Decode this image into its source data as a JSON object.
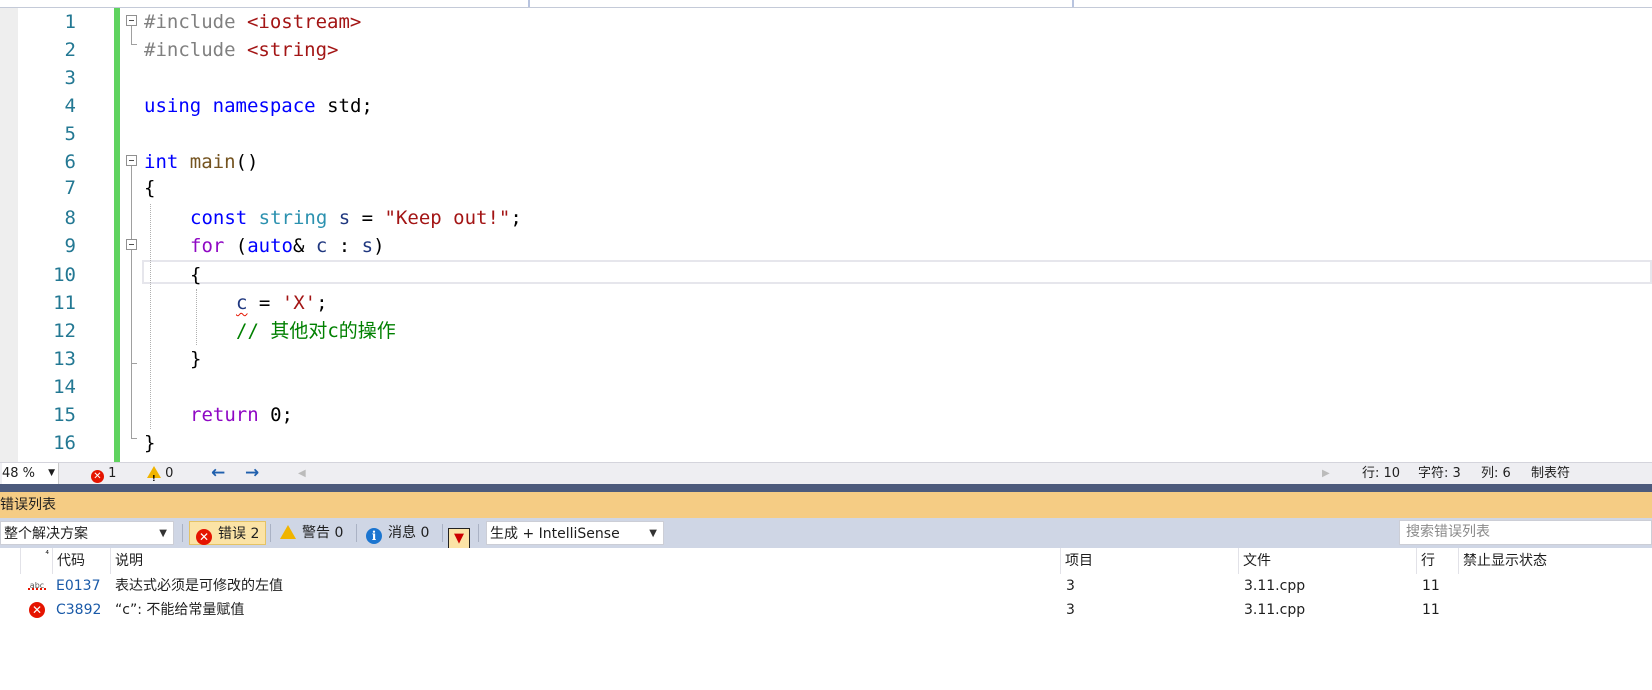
{
  "editor": {
    "line_numbers": [
      "1",
      "2",
      "3",
      "4",
      "5",
      "6",
      "7",
      "8",
      "9",
      "10",
      "11",
      "12",
      "13",
      "14",
      "15",
      "16"
    ],
    "code": {
      "l1": {
        "directive": "#include",
        "header": "<iostream>"
      },
      "l2": {
        "directive": "#include",
        "header": "<string>"
      },
      "l4": {
        "using": "using",
        "namespace": "namespace",
        "name": "std",
        "semi": ";"
      },
      "l6": {
        "type": "int",
        "func": "main",
        "parens": "()"
      },
      "l7": {
        "brace": "{"
      },
      "l8": {
        "const": "const",
        "type": "string",
        "var": "s",
        "eq": " = ",
        "value": "\"Keep out!\"",
        "semi": ";"
      },
      "l9": {
        "for": "for",
        "open": " (",
        "auto": "auto",
        "amp": "&",
        "var": "c",
        "colon": " : ",
        "range": "s",
        "close": ")"
      },
      "l10": {
        "brace": "{"
      },
      "l11": {
        "var": "c",
        "eq": " = ",
        "value": "'X'",
        "semi": ";"
      },
      "l12": {
        "comment": "// 其他对c的操作"
      },
      "l13": {
        "brace": "}"
      },
      "l15": {
        "ret": "return",
        "value": " 0;"
      },
      "l16": {
        "brace": "}"
      }
    }
  },
  "status_bar": {
    "zoom": "48 %",
    "errors": "1",
    "warnings": "0",
    "line": "行: 10",
    "char": "字符: 3",
    "col": "列: 6",
    "tabs": "制表符"
  },
  "error_list": {
    "title": "错误列表",
    "scope": "整个解决方案",
    "errors_btn": "错误 2",
    "warnings_btn": "警告 0",
    "messages_btn": "消息 0",
    "build_source": "生成 + IntelliSense",
    "search_placeholder": "搜索错误列表",
    "columns": {
      "code": "代码",
      "desc": "说明",
      "project": "项目",
      "file": "文件",
      "line": "行",
      "suppress": "禁止显示状态"
    },
    "rows": [
      {
        "icon": "intellisense-error-icon",
        "code": "E0137",
        "desc": "表达式必须是可修改的左值",
        "project": "3",
        "file": "3.11.cpp",
        "line": "11",
        "suppress": ""
      },
      {
        "icon": "error-icon",
        "code": "C3892",
        "desc": "“c”: 不能给常量赋值",
        "project": "3",
        "file": "3.11.cpp",
        "line": "11",
        "suppress": ""
      }
    ]
  },
  "colors": {
    "accent_error": "#e51400",
    "accent_warning": "#f0b400",
    "error_list_title": "#f5cc84",
    "change_bar": "#5fd35f"
  }
}
